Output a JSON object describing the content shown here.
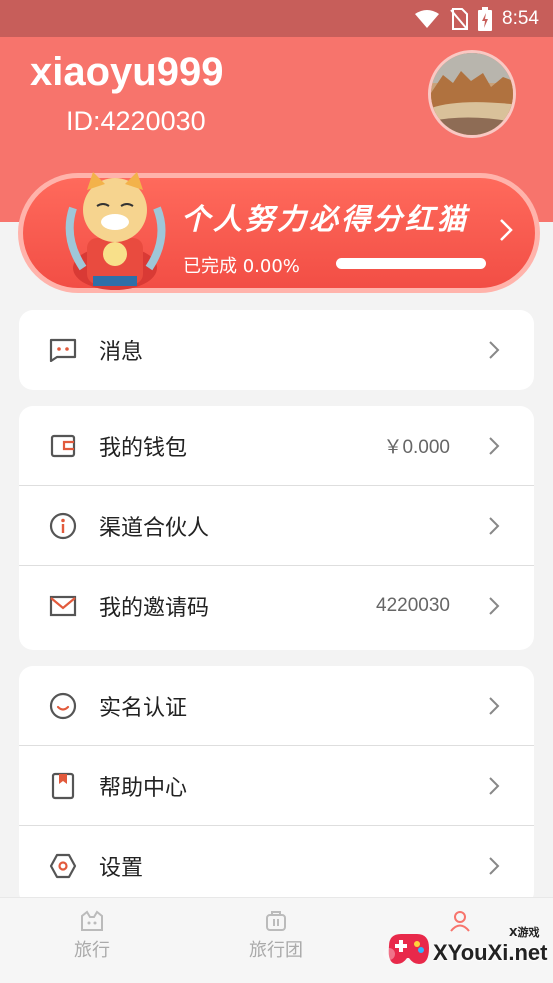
{
  "status_bar": {
    "time": "8:54",
    "icons": [
      "wifi-icon",
      "no-sim-icon",
      "battery-charging-icon"
    ]
  },
  "profile": {
    "username": "xiaoyu999",
    "id_text": "ID:4220030"
  },
  "banner": {
    "title": "个人努力必得分红猫",
    "progress_text": "已完成 0.00%",
    "progress_value": 0.0
  },
  "menu": {
    "messages": {
      "label": "消息",
      "icon": "message-icon"
    },
    "wallet": {
      "label": "我的钱包",
      "value": "￥0.000",
      "icon": "wallet-icon"
    },
    "partner": {
      "label": "渠道合伙人",
      "icon": "info-icon"
    },
    "invite": {
      "label": "我的邀请码",
      "value": "4220030",
      "icon": "mail-icon"
    },
    "verify": {
      "label": "实名认证",
      "icon": "smile-icon"
    },
    "help": {
      "label": "帮助中心",
      "icon": "bookmark-icon"
    },
    "settings": {
      "label": "设置",
      "icon": "hexagon-settings-icon"
    }
  },
  "bottom_nav": {
    "travel": "旅行",
    "tour_group": "旅行团"
  },
  "watermark": {
    "brand": "XYouXi.net",
    "small": "X游戏"
  },
  "colors": {
    "header": "#f7746c",
    "status_bar": "#c75e5a",
    "icon_accent": "#e25a3c",
    "icon_gray": "#555555"
  }
}
